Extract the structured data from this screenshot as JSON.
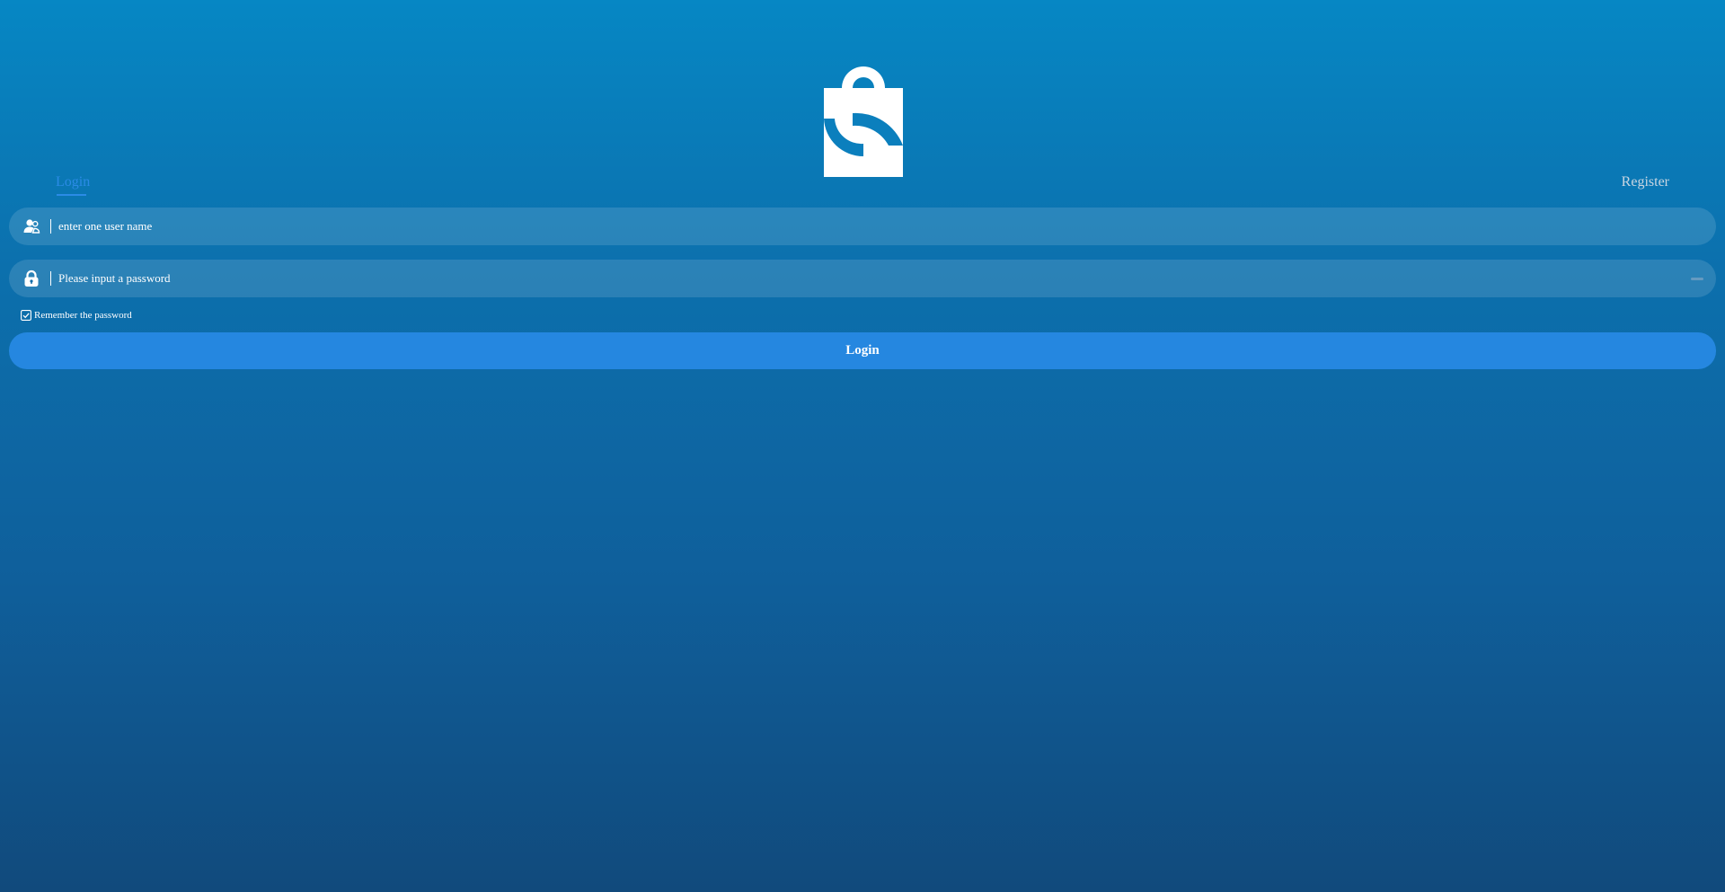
{
  "tabs": {
    "login": "Login",
    "register": "Register"
  },
  "form": {
    "username_placeholder": "enter one user name",
    "password_placeholder": "Please input a password",
    "remember_label": "Remember the password",
    "remember_checked": true,
    "submit_label": "Login"
  },
  "icons": {
    "logo": "shopping-bag-s-logo",
    "username": "users-icon",
    "password": "lock-icon",
    "toggle_visibility": "eye-closed-icon",
    "checkbox": "checkbox-checked-icon"
  },
  "colors": {
    "accent": "#2587e0",
    "active_tab": "#2b8be6",
    "inactive_tab": "#c9d6e2"
  }
}
